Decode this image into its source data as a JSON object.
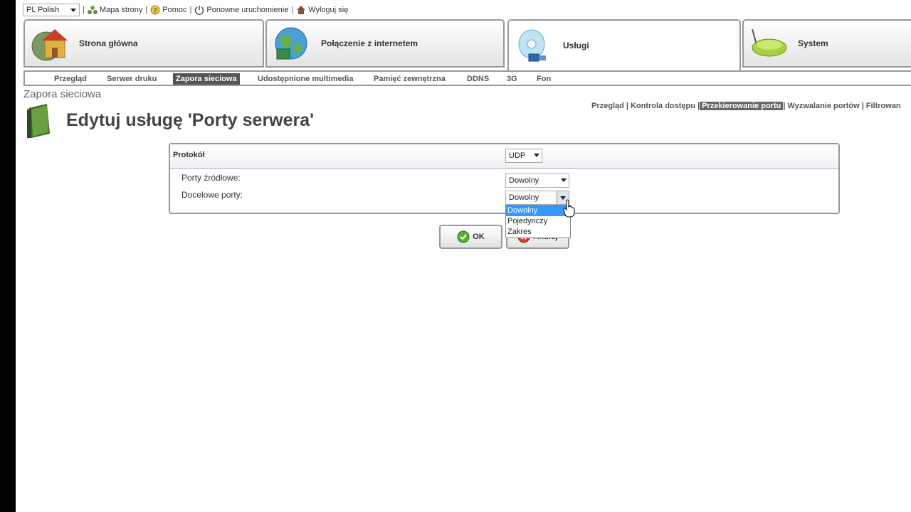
{
  "topbar": {
    "language": "PL Polish",
    "links": [
      {
        "label": "Mapa strony",
        "icon": "sitemap-icon"
      },
      {
        "label": "Pomoc",
        "icon": "help-icon"
      },
      {
        "label": "Ponowne uruchomienie",
        "icon": "power-icon"
      },
      {
        "label": "Wyloguj się",
        "icon": "logout-house-icon"
      }
    ]
  },
  "main_tabs": [
    {
      "label": "Strona główna",
      "icon": "home-globe-icon"
    },
    {
      "label": "Połączenie z internetem",
      "icon": "internet-globe-icon"
    },
    {
      "label": "Usługi",
      "icon": "services-disc-icon",
      "active": true
    },
    {
      "label": "System",
      "icon": "router-icon"
    }
  ],
  "sub_tabs": [
    "Przegląd",
    "Serwer druku",
    "Zapora sieciowa",
    "Udostępnione multimedia",
    "Pamięć zewnętrzna",
    "DDNS",
    "3G",
    "Fon"
  ],
  "sub_tabs_active": "Zapora sieciowa",
  "breadcrumb": "Zapora sieciowa",
  "page_title": "Edytuj usługę 'Porty serwera'",
  "right_links": [
    "Przegląd",
    "Kontrola dostępu",
    "Przekierowanie portu",
    "Wyzwalanie portów",
    "Filtrowan"
  ],
  "right_links_active": "Przekierowanie portu",
  "form": {
    "protocol_label": "Protokół",
    "protocol_value": "UDP",
    "source_ports_label": "Porty źródłowe:",
    "source_ports_value": "Dowolny",
    "dest_ports_label": "Docelowe porty:",
    "dest_ports_value": "Dowolny",
    "dest_ports_options": [
      "Dowolny",
      "Pojedynczy",
      "Zakres"
    ],
    "dest_ports_highlighted": "Dowolny"
  },
  "buttons": {
    "ok": "OK",
    "cancel": "Anuluj"
  },
  "colors": {
    "active_tab_bg": "#555555",
    "dropdown_highlight": "#3399ff",
    "border": "#999999"
  }
}
